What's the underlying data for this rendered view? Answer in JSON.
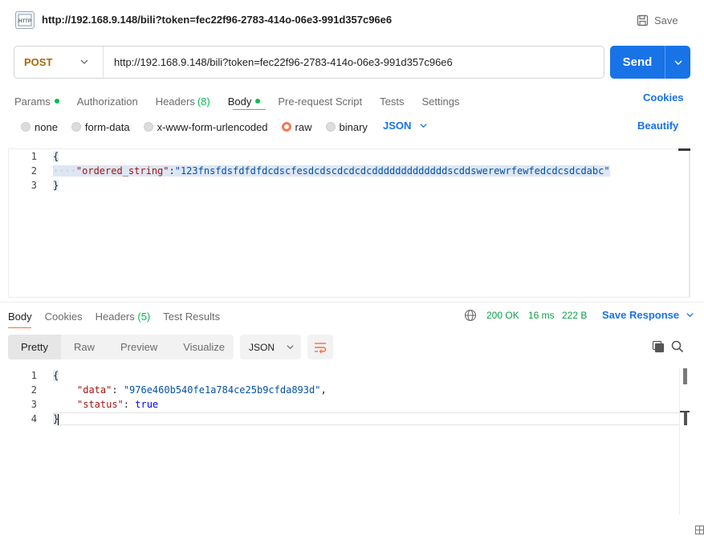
{
  "title_bar": {
    "icon_text": "HTTP",
    "url": "http://192.168.9.148/bili?token=fec22f96-2783-414o-06e3-991d357c96e6",
    "save_label": "Save"
  },
  "request": {
    "method": "POST",
    "url": "http://192.168.9.148/bili?token=fec22f96-2783-414o-06e3-991d357c96e6",
    "send_label": "Send"
  },
  "request_tabs": {
    "params": "Params",
    "authorization": "Authorization",
    "headers": "Headers",
    "headers_count": "(8)",
    "body": "Body",
    "pre_request": "Pre-request Script",
    "tests": "Tests",
    "settings": "Settings",
    "active": "Body",
    "cookies": "Cookies"
  },
  "body_types": {
    "options": [
      "none",
      "form-data",
      "x-www-form-urlencoded",
      "raw",
      "binary"
    ],
    "selected": "raw",
    "format": "JSON",
    "beautify": "Beautify"
  },
  "request_body": {
    "line_numbers": [
      "1",
      "2",
      "3"
    ],
    "open_brace": "{",
    "indent": "····",
    "key": "\"ordered_string\"",
    "colon": ":",
    "value": "\"123fnsfdsfdfdfdcdscfesdcdscdcdcdcdddddddddddddscddswerewrfewfedcdcsdcdabc\"",
    "close_brace": "}"
  },
  "response_tabs": {
    "body": "Body",
    "cookies": "Cookies",
    "headers": "Headers",
    "headers_count": "(5)",
    "test_results": "Test Results",
    "active": "Body"
  },
  "response_meta": {
    "status": "200 OK",
    "time": "16 ms",
    "size": "222 B",
    "save_response": "Save Response"
  },
  "view_modes": {
    "pretty": "Pretty",
    "raw": "Raw",
    "preview": "Preview",
    "visualize": "Visualize",
    "active": "Pretty",
    "format": "JSON"
  },
  "response_body": {
    "line_numbers": [
      "1",
      "2",
      "3",
      "4"
    ],
    "open_brace": "{",
    "data_key": "\"data\"",
    "data_value": "\"976e460b540fe1a784ce25b9cfda893d\"",
    "status_key": "\"status\"",
    "status_value": "true",
    "close_brace": "}"
  },
  "colors": {
    "accent_blue": "#1773e6",
    "method_post": "#a5690b",
    "success_green": "#0a9e48",
    "active_tab_underline": "#ff6c37"
  },
  "icons": [
    "http-file-icon",
    "save-disk-icon",
    "chevron-down-icon",
    "globe-icon",
    "copy-icon",
    "search-icon",
    "wrap-lines-icon"
  ]
}
